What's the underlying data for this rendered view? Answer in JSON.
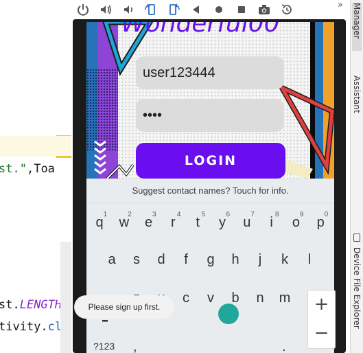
{
  "ide": {
    "line1_string": "st.\"",
    "line1_sep": ",",
    "line1_rest": "Toa",
    "line2_prefix": "st.",
    "line2_field": "LENGTH",
    "line2_suffix": "_",
    "line3_prefix": "tivity.",
    "line3_class": "cl"
  },
  "toolbar": {
    "icons": [
      "power-icon",
      "volume-up-icon",
      "volume-down-icon",
      "rotate-left-icon",
      "rotate-right-icon",
      "back-icon",
      "home-icon",
      "overview-icon",
      "camera-icon",
      "replay-icon"
    ],
    "overflow": "»"
  },
  "right_strip": {
    "tab1": "Manager",
    "tab2": "Assistant",
    "tab3": "Device File Explorer"
  },
  "app": {
    "title_partial": "Wonderful00",
    "username_value": "user123444",
    "password_value": "••••",
    "login_label": "LOGIN"
  },
  "keyboard": {
    "suggestion": "Suggest contact names? Touch for info.",
    "row1": [
      [
        "q",
        "1"
      ],
      [
        "w",
        "2"
      ],
      [
        "e",
        "3"
      ],
      [
        "r",
        "4"
      ],
      [
        "t",
        "5"
      ],
      [
        "y",
        "6"
      ],
      [
        "u",
        "7"
      ],
      [
        "i",
        "8"
      ],
      [
        "o",
        "9"
      ],
      [
        "p",
        "0"
      ]
    ],
    "row2": [
      "a",
      "s",
      "d",
      "f",
      "g",
      "h",
      "j",
      "k",
      "l"
    ],
    "row3": [
      "z",
      "x",
      "c",
      "v",
      "b",
      "n",
      "m"
    ],
    "symbols_label": "?123",
    "comma": ",",
    "period": "."
  },
  "toast": "Please sign up first.",
  "zoom": {
    "plus": "+",
    "minus": "−"
  },
  "colors": {
    "accent": "#6a0ef0",
    "stripe_blue": "#2673b8",
    "stripe_orange": "#f0a12b",
    "triangle_red": "#e04040",
    "triangle_cyan": "#1ea7d6"
  }
}
